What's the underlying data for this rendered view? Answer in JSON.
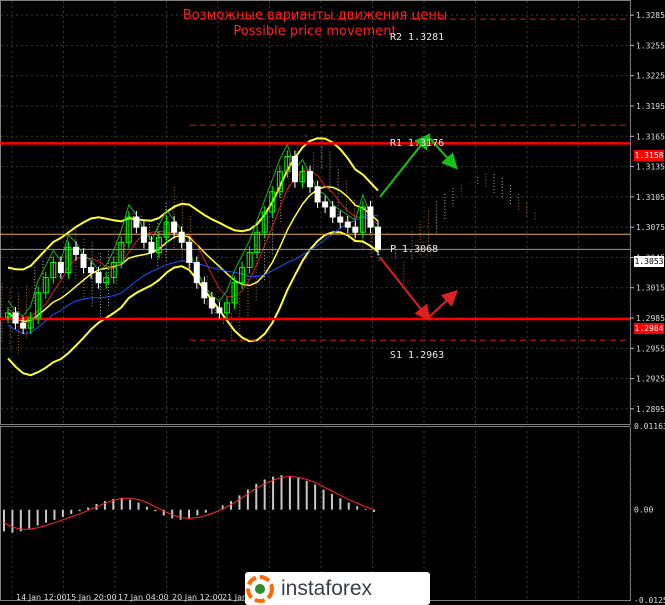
{
  "header": {
    "title_ru": "Возможные варианты движения цены",
    "title_en": "Possible price movement"
  },
  "levels": {
    "r2": "R2 1.3281",
    "r1": "R1 1.3176",
    "pivot": "P 1.3068",
    "s1": "S1 1.2963"
  },
  "price_tags": {
    "upper_red": "1.3158",
    "current": "1.3053",
    "lower_red": "1.2984"
  },
  "logo": {
    "text": "instaforex"
  },
  "colors": {
    "background": "#000000",
    "grid": "#3a3a3a",
    "red_level": "#ff0000",
    "bollinger": "#ffff33",
    "pivot_line": "#e0b04a",
    "bull_candle": "#00ff00",
    "bear_candle": "#ffffff",
    "arrow_up": "#18c018",
    "arrow_down": "#e02020",
    "macd_hist": "#c8c8c8",
    "macd_signal": "#ff2a2a"
  },
  "chart_data": [
    {
      "type": "candlestick",
      "yticks": [
        "1.3285",
        "1.3255",
        "1.3225",
        "1.3195",
        "1.3165",
        "1.3135",
        "1.3105",
        "1.3075",
        "1.3045",
        "1.3015",
        "1.2985",
        "1.2955",
        "1.2925",
        "1.2895"
      ],
      "ylim": [
        1.288,
        1.33
      ],
      "horizontal_levels": [
        {
          "name": "R2",
          "value": 1.3281
        },
        {
          "name": "R1",
          "value": 1.3176
        },
        {
          "name": "P",
          "value": 1.3068
        },
        {
          "name": "S1",
          "value": 1.2963
        },
        {
          "name": "resistance",
          "value": 1.3158
        },
        {
          "name": "support",
          "value": 1.2984
        }
      ],
      "last_price": 1.3053,
      "closes": [
        1.299,
        1.298,
        1.2975,
        1.2985,
        1.301,
        1.3025,
        1.304,
        1.303,
        1.3055,
        1.3048,
        1.3035,
        1.303,
        1.302,
        1.3025,
        1.304,
        1.306,
        1.3085,
        1.3075,
        1.306,
        1.305,
        1.3065,
        1.308,
        1.307,
        1.306,
        1.304,
        1.302,
        1.3005,
        1.2995,
        1.299,
        1.3,
        1.302,
        1.3035,
        1.305,
        1.307,
        1.309,
        1.311,
        1.313,
        1.3145,
        1.312,
        1.313,
        1.3115,
        1.31,
        1.3095,
        1.3085,
        1.308,
        1.3075,
        1.307,
        1.3095,
        1.3075,
        1.3053
      ],
      "projections": [
        {
          "direction": "up",
          "from": 1.3105,
          "to": 1.3165,
          "then": 1.3135
        },
        {
          "direction": "down",
          "from": 1.3045,
          "to": 1.2985,
          "then": 1.301
        }
      ]
    },
    {
      "type": "bar",
      "name": "MACD",
      "yticks": [
        "0.01163",
        "0.00",
        "-0.01254"
      ],
      "ylim": [
        -0.01254,
        0.01163
      ],
      "values": [
        -0.003,
        -0.0032,
        -0.003,
        -0.0026,
        -0.0022,
        -0.0018,
        -0.0014,
        -0.001,
        -0.0006,
        -0.0002,
        0.0003,
        0.0008,
        0.0012,
        0.0015,
        0.0016,
        0.0014,
        0.001,
        0.0004,
        -0.0002,
        -0.0008,
        -0.0012,
        -0.0014,
        -0.0012,
        -0.0008,
        -0.0004,
        0.0,
        0.0006,
        0.0012,
        0.002,
        0.0028,
        0.0036,
        0.0042,
        0.0046,
        0.0048,
        0.0047,
        0.0044,
        0.004,
        0.0035,
        0.0028,
        0.0022,
        0.0016,
        0.001,
        0.0005,
        0.0001,
        -0.0003
      ],
      "signal": [
        -0.0018,
        -0.0024,
        -0.0027,
        -0.0027,
        -0.0025,
        -0.0022,
        -0.0018,
        -0.0014,
        -0.001,
        -0.0006,
        -0.0001,
        0.0004,
        0.0009,
        0.0013,
        0.0016,
        0.0016,
        0.0014,
        0.001,
        0.0004,
        -0.0002,
        -0.0007,
        -0.0011,
        -0.0012,
        -0.0011,
        -0.0008,
        -0.0004,
        0.0001,
        0.0007,
        0.0014,
        0.0022,
        0.003,
        0.0036,
        0.0041,
        0.0045,
        0.0046,
        0.0045,
        0.0042,
        0.0038,
        0.0032,
        0.0026,
        0.002,
        0.0014,
        0.0009,
        0.0004,
        0.0
      ],
      "x_labels": [
        "14 Jan 12:00",
        "15 Jan 20:00",
        "17 Jan 04:00",
        "20 Jan 12:00",
        "21 Jan"
      ]
    }
  ]
}
